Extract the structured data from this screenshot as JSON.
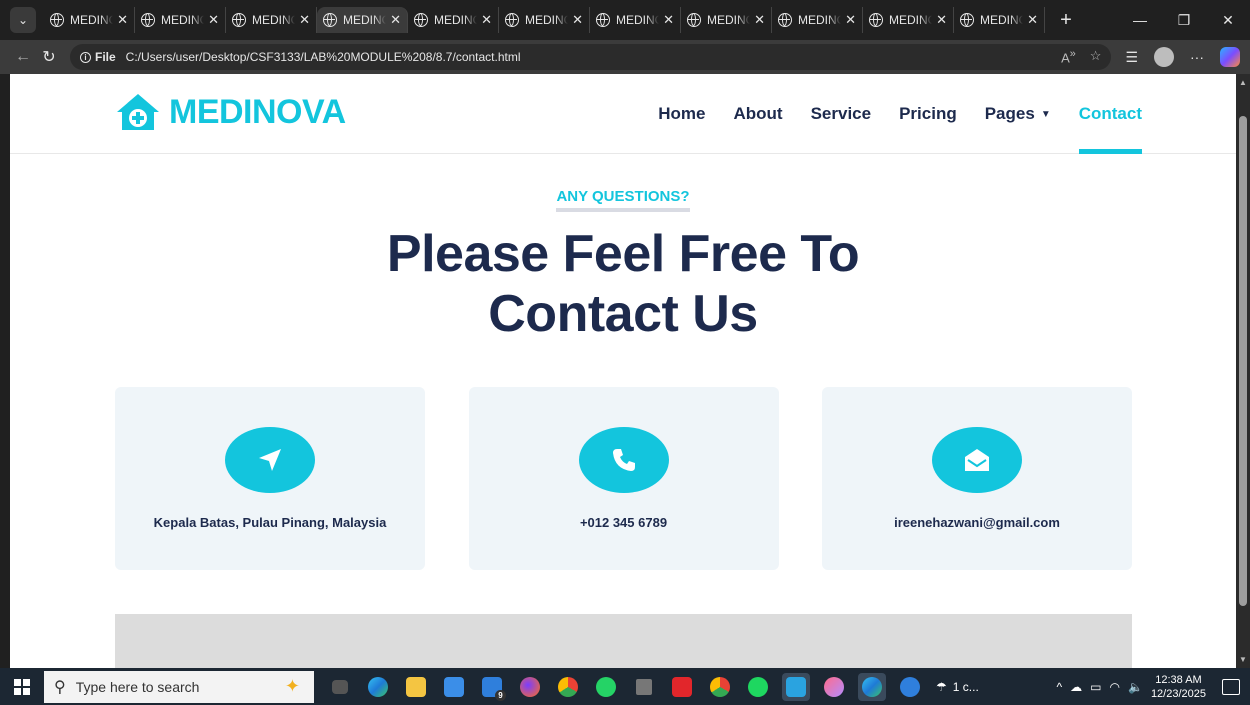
{
  "browser": {
    "tabs": [
      {
        "title": "MEDINOVA",
        "active": false
      },
      {
        "title": "MEDINOVA",
        "active": false
      },
      {
        "title": "MEDINOVA",
        "active": false
      },
      {
        "title": "MEDINOVA",
        "active": true
      },
      {
        "title": "MEDINOVA",
        "active": false
      },
      {
        "title": "MEDINOVA",
        "active": false
      },
      {
        "title": "MEDINOVA",
        "active": false
      },
      {
        "title": "MEDINOVA",
        "active": false
      },
      {
        "title": "MEDINOVA",
        "active": false
      },
      {
        "title": "MEDINOVA",
        "active": false
      },
      {
        "title": "MEDINOVA",
        "active": false
      }
    ],
    "file_label": "File",
    "url": "C:/Users/user/Desktop/CSF3133/LAB%20MODULE%208/8.7/contact.html"
  },
  "site": {
    "logo_text": "MEDINOVA",
    "brand_color": "#13c5dd",
    "nav": [
      {
        "label": "Home"
      },
      {
        "label": "About"
      },
      {
        "label": "Service"
      },
      {
        "label": "Pricing"
      },
      {
        "label": "Pages"
      },
      {
        "label": "Contact"
      }
    ],
    "eyebrow": "ANY QUESTIONS?",
    "headline_line1": "Please Feel Free To",
    "headline_line2": "Contact Us",
    "cards": [
      {
        "icon": "location-arrow-icon",
        "text": "Kepala Batas, Pulau Pinang, Malaysia"
      },
      {
        "icon": "phone-icon",
        "text": "+012 345 6789"
      },
      {
        "icon": "envelope-open-icon",
        "text": "ireenehazwani@gmail.com"
      }
    ]
  },
  "taskbar": {
    "search_placeholder": "Type here to search",
    "weather": "1 c...",
    "time": "12:38 AM",
    "date": "12/23/2025",
    "mail_badge": "9"
  }
}
